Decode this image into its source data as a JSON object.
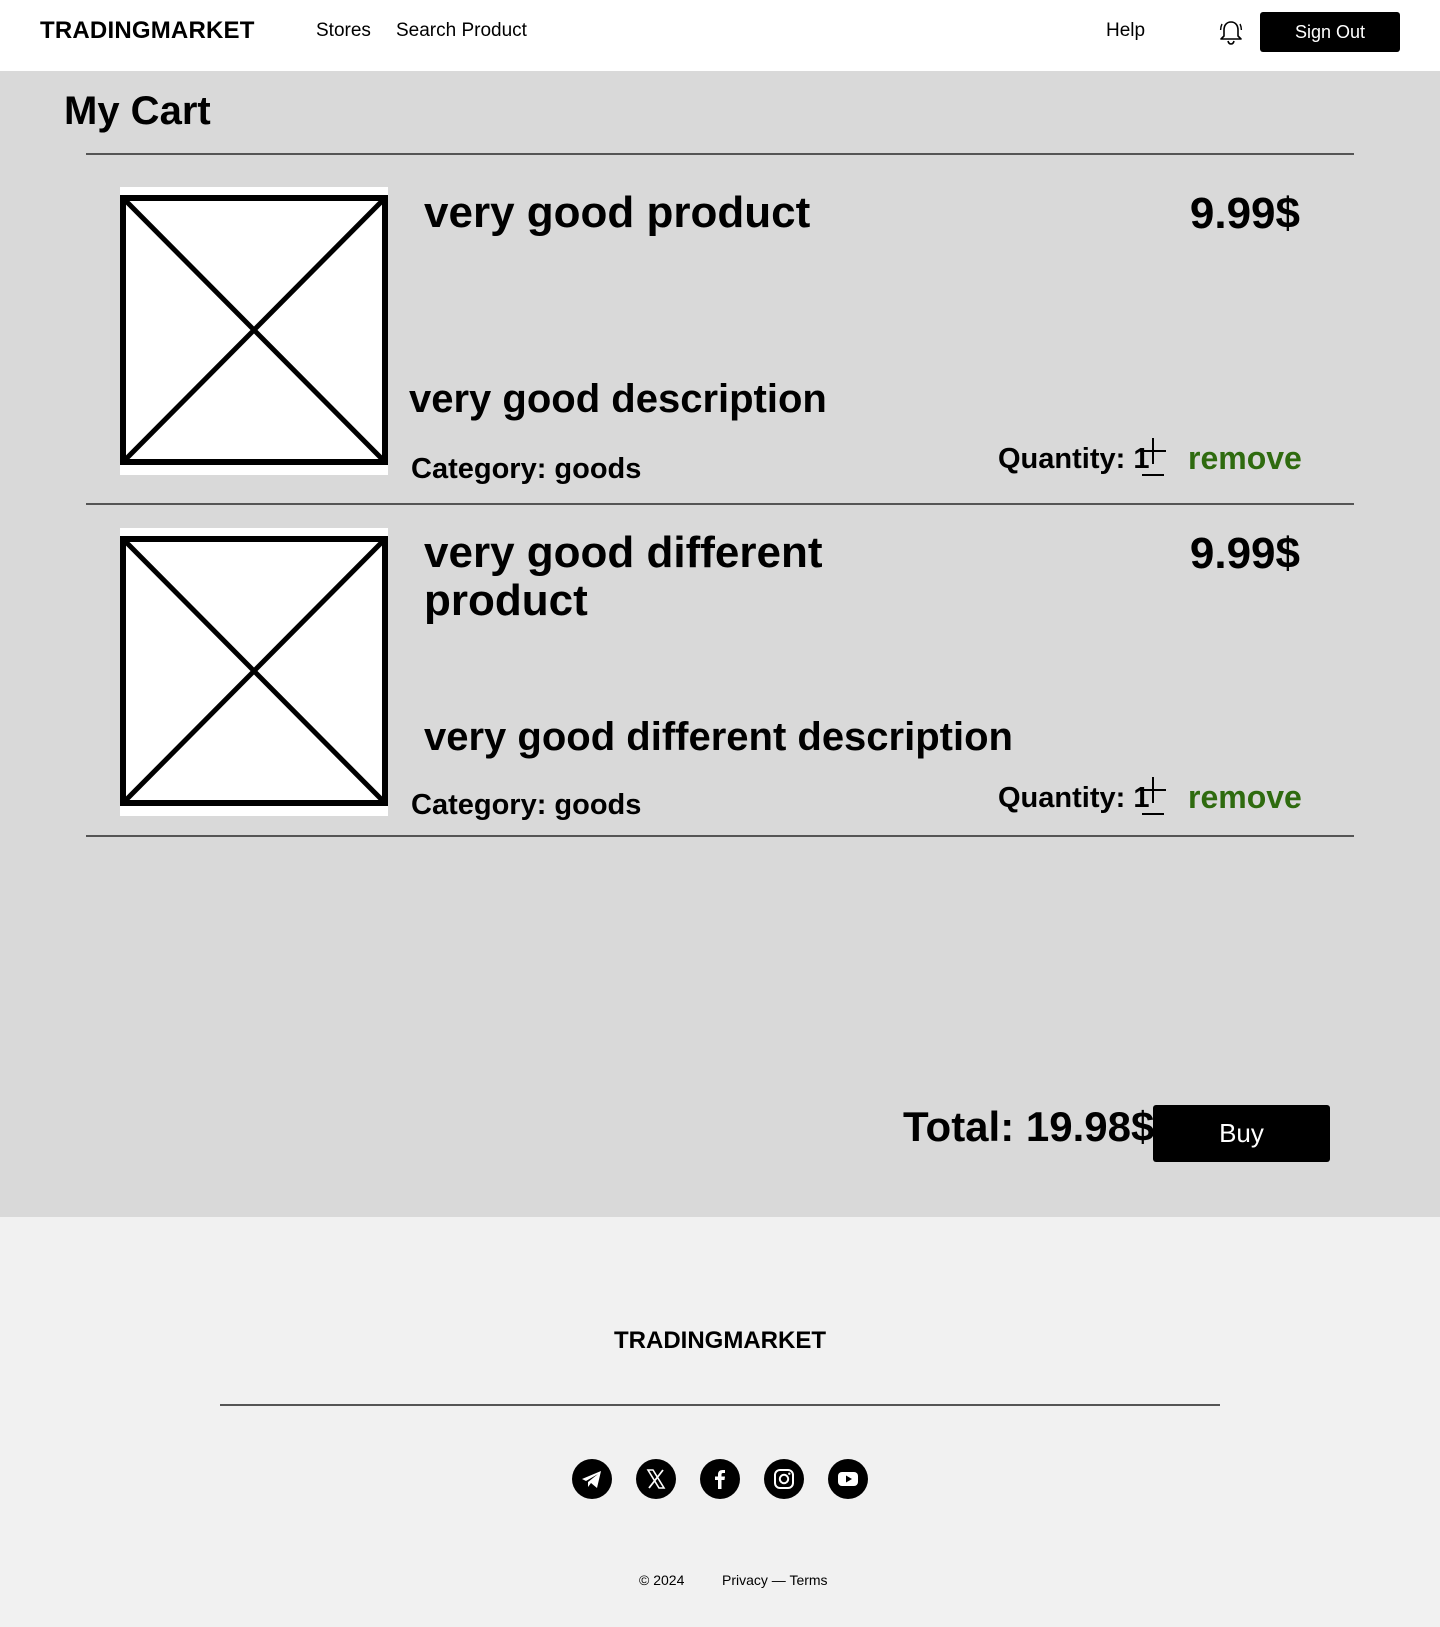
{
  "header": {
    "brand": "TRADINGMARKET",
    "nav": {
      "stores": "Stores",
      "search_product": "Search Product",
      "help": "Help"
    },
    "sign_out_label": "Sign Out",
    "notification_icon": "bell-icon"
  },
  "cart": {
    "title": "My Cart",
    "items": [
      {
        "name": "very good product",
        "price": "9.99$",
        "description": "very good description",
        "category": "Category: goods",
        "quantity": "Quantity: 1",
        "remove_label": "remove",
        "image_icon": "image-placeholder-icon"
      },
      {
        "name": "very good different product",
        "price": "9.99$",
        "description": "very good different description",
        "category": "Category: goods",
        "quantity": "Quantity: 1",
        "remove_label": "remove",
        "image_icon": "image-placeholder-icon"
      }
    ],
    "total": "Total: 19.98$",
    "buy_label": "Buy",
    "remove_color": "#2f6b0f"
  },
  "footer": {
    "brand": "TRADINGMARKET",
    "socials": [
      "telegram-icon",
      "x-icon",
      "facebook-icon",
      "instagram-icon",
      "youtube-icon"
    ],
    "copyright": "© 2024",
    "privacy": "Privacy",
    "separator": " — ",
    "terms": "Terms"
  }
}
